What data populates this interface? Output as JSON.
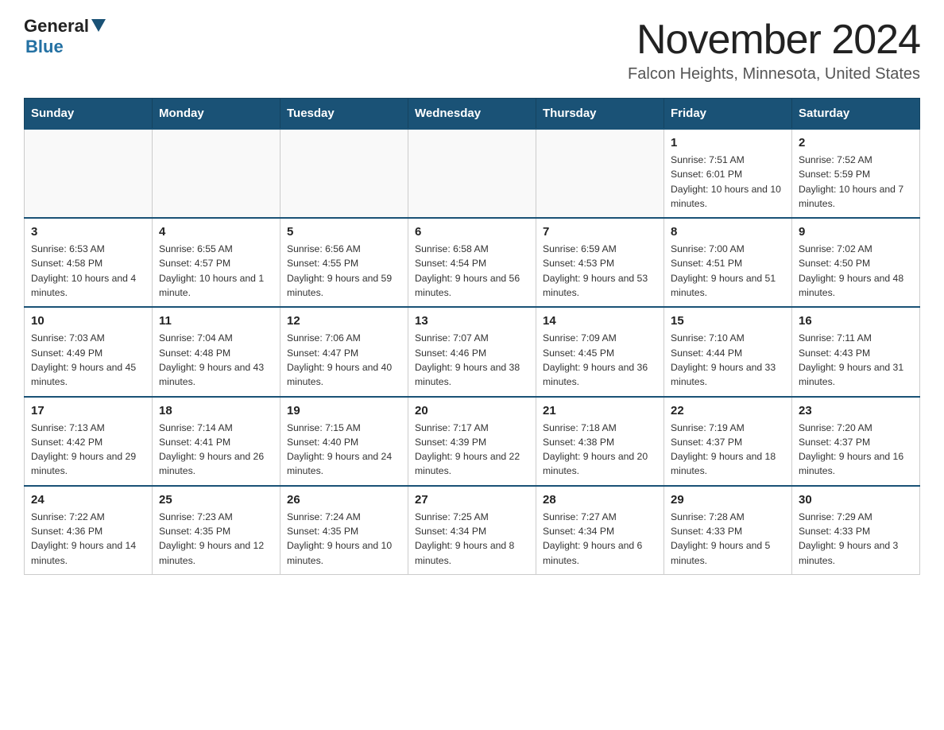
{
  "logo": {
    "general": "General",
    "triangle_color": "#1a5276",
    "blue": "Blue"
  },
  "header": {
    "title": "November 2024",
    "subtitle": "Falcon Heights, Minnesota, United States"
  },
  "calendar": {
    "days_of_week": [
      "Sunday",
      "Monday",
      "Tuesday",
      "Wednesday",
      "Thursday",
      "Friday",
      "Saturday"
    ],
    "weeks": [
      [
        {
          "day": "",
          "info": ""
        },
        {
          "day": "",
          "info": ""
        },
        {
          "day": "",
          "info": ""
        },
        {
          "day": "",
          "info": ""
        },
        {
          "day": "",
          "info": ""
        },
        {
          "day": "1",
          "info": "Sunrise: 7:51 AM\nSunset: 6:01 PM\nDaylight: 10 hours and 10 minutes."
        },
        {
          "day": "2",
          "info": "Sunrise: 7:52 AM\nSunset: 5:59 PM\nDaylight: 10 hours and 7 minutes."
        }
      ],
      [
        {
          "day": "3",
          "info": "Sunrise: 6:53 AM\nSunset: 4:58 PM\nDaylight: 10 hours and 4 minutes."
        },
        {
          "day": "4",
          "info": "Sunrise: 6:55 AM\nSunset: 4:57 PM\nDaylight: 10 hours and 1 minute."
        },
        {
          "day": "5",
          "info": "Sunrise: 6:56 AM\nSunset: 4:55 PM\nDaylight: 9 hours and 59 minutes."
        },
        {
          "day": "6",
          "info": "Sunrise: 6:58 AM\nSunset: 4:54 PM\nDaylight: 9 hours and 56 minutes."
        },
        {
          "day": "7",
          "info": "Sunrise: 6:59 AM\nSunset: 4:53 PM\nDaylight: 9 hours and 53 minutes."
        },
        {
          "day": "8",
          "info": "Sunrise: 7:00 AM\nSunset: 4:51 PM\nDaylight: 9 hours and 51 minutes."
        },
        {
          "day": "9",
          "info": "Sunrise: 7:02 AM\nSunset: 4:50 PM\nDaylight: 9 hours and 48 minutes."
        }
      ],
      [
        {
          "day": "10",
          "info": "Sunrise: 7:03 AM\nSunset: 4:49 PM\nDaylight: 9 hours and 45 minutes."
        },
        {
          "day": "11",
          "info": "Sunrise: 7:04 AM\nSunset: 4:48 PM\nDaylight: 9 hours and 43 minutes."
        },
        {
          "day": "12",
          "info": "Sunrise: 7:06 AM\nSunset: 4:47 PM\nDaylight: 9 hours and 40 minutes."
        },
        {
          "day": "13",
          "info": "Sunrise: 7:07 AM\nSunset: 4:46 PM\nDaylight: 9 hours and 38 minutes."
        },
        {
          "day": "14",
          "info": "Sunrise: 7:09 AM\nSunset: 4:45 PM\nDaylight: 9 hours and 36 minutes."
        },
        {
          "day": "15",
          "info": "Sunrise: 7:10 AM\nSunset: 4:44 PM\nDaylight: 9 hours and 33 minutes."
        },
        {
          "day": "16",
          "info": "Sunrise: 7:11 AM\nSunset: 4:43 PM\nDaylight: 9 hours and 31 minutes."
        }
      ],
      [
        {
          "day": "17",
          "info": "Sunrise: 7:13 AM\nSunset: 4:42 PM\nDaylight: 9 hours and 29 minutes."
        },
        {
          "day": "18",
          "info": "Sunrise: 7:14 AM\nSunset: 4:41 PM\nDaylight: 9 hours and 26 minutes."
        },
        {
          "day": "19",
          "info": "Sunrise: 7:15 AM\nSunset: 4:40 PM\nDaylight: 9 hours and 24 minutes."
        },
        {
          "day": "20",
          "info": "Sunrise: 7:17 AM\nSunset: 4:39 PM\nDaylight: 9 hours and 22 minutes."
        },
        {
          "day": "21",
          "info": "Sunrise: 7:18 AM\nSunset: 4:38 PM\nDaylight: 9 hours and 20 minutes."
        },
        {
          "day": "22",
          "info": "Sunrise: 7:19 AM\nSunset: 4:37 PM\nDaylight: 9 hours and 18 minutes."
        },
        {
          "day": "23",
          "info": "Sunrise: 7:20 AM\nSunset: 4:37 PM\nDaylight: 9 hours and 16 minutes."
        }
      ],
      [
        {
          "day": "24",
          "info": "Sunrise: 7:22 AM\nSunset: 4:36 PM\nDaylight: 9 hours and 14 minutes."
        },
        {
          "day": "25",
          "info": "Sunrise: 7:23 AM\nSunset: 4:35 PM\nDaylight: 9 hours and 12 minutes."
        },
        {
          "day": "26",
          "info": "Sunrise: 7:24 AM\nSunset: 4:35 PM\nDaylight: 9 hours and 10 minutes."
        },
        {
          "day": "27",
          "info": "Sunrise: 7:25 AM\nSunset: 4:34 PM\nDaylight: 9 hours and 8 minutes."
        },
        {
          "day": "28",
          "info": "Sunrise: 7:27 AM\nSunset: 4:34 PM\nDaylight: 9 hours and 6 minutes."
        },
        {
          "day": "29",
          "info": "Sunrise: 7:28 AM\nSunset: 4:33 PM\nDaylight: 9 hours and 5 minutes."
        },
        {
          "day": "30",
          "info": "Sunrise: 7:29 AM\nSunset: 4:33 PM\nDaylight: 9 hours and 3 minutes."
        }
      ]
    ]
  }
}
